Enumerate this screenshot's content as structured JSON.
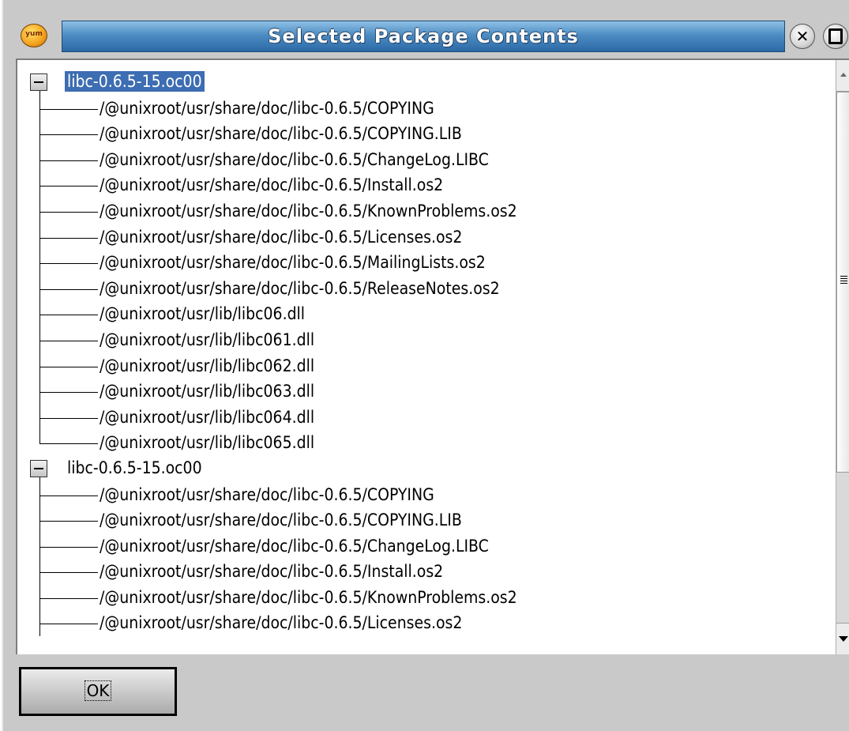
{
  "window": {
    "title": "Selected Package Contents",
    "app_icon_text": "yum",
    "close_symbol": "✕",
    "icons": {
      "app": "yum-icon",
      "close": "close-icon",
      "maximize": "maximize-icon"
    }
  },
  "tree": {
    "selection_color": "#3d6db2",
    "packages": [
      {
        "name": "libc-0.6.5-15.oc00",
        "selected": true,
        "expanded": true,
        "files": [
          "/@unixroot/usr/share/doc/libc-0.6.5/COPYING",
          "/@unixroot/usr/share/doc/libc-0.6.5/COPYING.LIB",
          "/@unixroot/usr/share/doc/libc-0.6.5/ChangeLog.LIBC",
          "/@unixroot/usr/share/doc/libc-0.6.5/Install.os2",
          "/@unixroot/usr/share/doc/libc-0.6.5/KnownProblems.os2",
          "/@unixroot/usr/share/doc/libc-0.6.5/Licenses.os2",
          "/@unixroot/usr/share/doc/libc-0.6.5/MailingLists.os2",
          "/@unixroot/usr/share/doc/libc-0.6.5/ReleaseNotes.os2",
          "/@unixroot/usr/lib/libc06.dll",
          "/@unixroot/usr/lib/libc061.dll",
          "/@unixroot/usr/lib/libc062.dll",
          "/@unixroot/usr/lib/libc063.dll",
          "/@unixroot/usr/lib/libc064.dll",
          "/@unixroot/usr/lib/libc065.dll"
        ]
      },
      {
        "name": "libc-0.6.5-15.oc00",
        "selected": false,
        "expanded": true,
        "files": [
          "/@unixroot/usr/share/doc/libc-0.6.5/COPYING",
          "/@unixroot/usr/share/doc/libc-0.6.5/COPYING.LIB",
          "/@unixroot/usr/share/doc/libc-0.6.5/ChangeLog.LIBC",
          "/@unixroot/usr/share/doc/libc-0.6.5/Install.os2",
          "/@unixroot/usr/share/doc/libc-0.6.5/KnownProblems.os2",
          "/@unixroot/usr/share/doc/libc-0.6.5/Licenses.os2"
        ]
      }
    ],
    "scrollbar": {
      "visible_fraction": 0.7,
      "scroll_position": 0.0
    }
  },
  "buttons": {
    "ok_label": "OK"
  }
}
